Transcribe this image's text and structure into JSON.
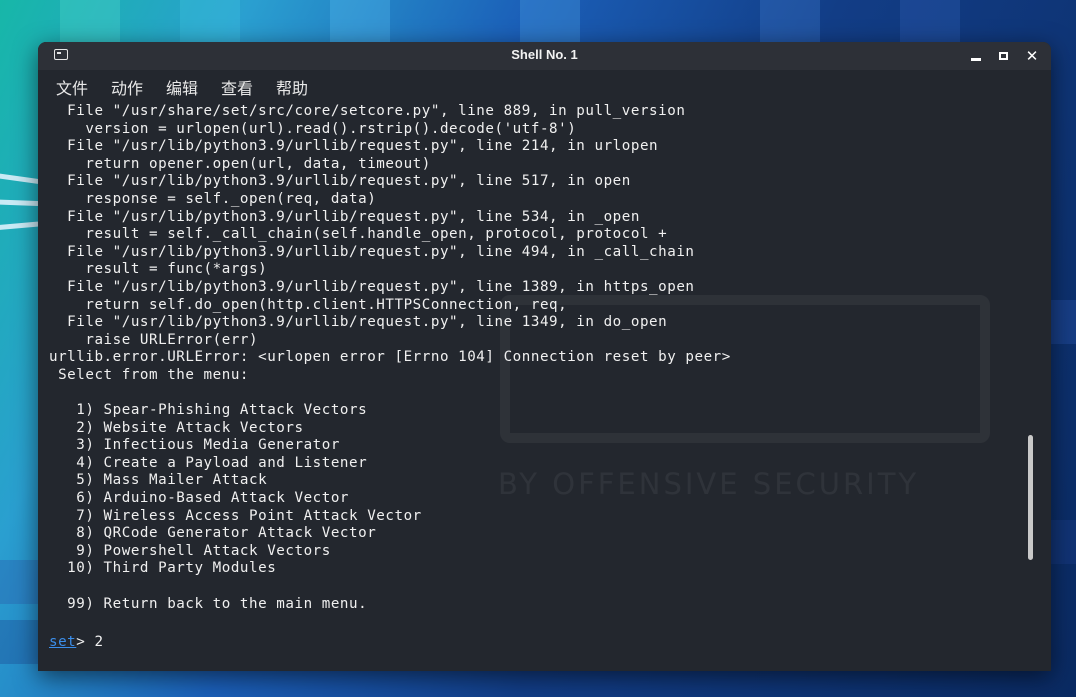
{
  "window": {
    "title": "Shell No. 1"
  },
  "menu": [
    "文件",
    "动作",
    "编辑",
    "查看",
    "帮助"
  ],
  "terminal": {
    "lines": [
      "  File \"/usr/share/set/src/core/setcore.py\", line 889, in pull_version",
      "    version = urlopen(url).read().rstrip().decode('utf-8')",
      "  File \"/usr/lib/python3.9/urllib/request.py\", line 214, in urlopen",
      "    return opener.open(url, data, timeout)",
      "  File \"/usr/lib/python3.9/urllib/request.py\", line 517, in open",
      "    response = self._open(req, data)",
      "  File \"/usr/lib/python3.9/urllib/request.py\", line 534, in _open",
      "    result = self._call_chain(self.handle_open, protocol, protocol +",
      "  File \"/usr/lib/python3.9/urllib/request.py\", line 494, in _call_chain",
      "    result = func(*args)",
      "  File \"/usr/lib/python3.9/urllib/request.py\", line 1389, in https_open",
      "    return self.do_open(http.client.HTTPSConnection, req,",
      "  File \"/usr/lib/python3.9/urllib/request.py\", line 1349, in do_open",
      "    raise URLError(err)",
      "urllib.error.URLError: <urlopen error [Errno 104] Connection reset by peer>",
      " Select from the menu:",
      "",
      "   1) Spear-Phishing Attack Vectors",
      "   2) Website Attack Vectors",
      "   3) Infectious Media Generator",
      "   4) Create a Payload and Listener",
      "   5) Mass Mailer Attack",
      "   6) Arduino-Based Attack Vector",
      "   7) Wireless Access Point Attack Vector",
      "   8) QRCode Generator Attack Vector",
      "   9) Powershell Attack Vectors",
      "  10) Third Party Modules",
      "",
      "  99) Return back to the main menu."
    ],
    "prompt": "set",
    "prompt_suffix": "> ",
    "input": "2"
  },
  "watermark": {
    "subtitle": "BY OFFENSIVE SECURITY"
  },
  "colors": {
    "terminal_bg": "#23272e",
    "text": "#f0f0f0",
    "prompt": "#3b8eea"
  }
}
